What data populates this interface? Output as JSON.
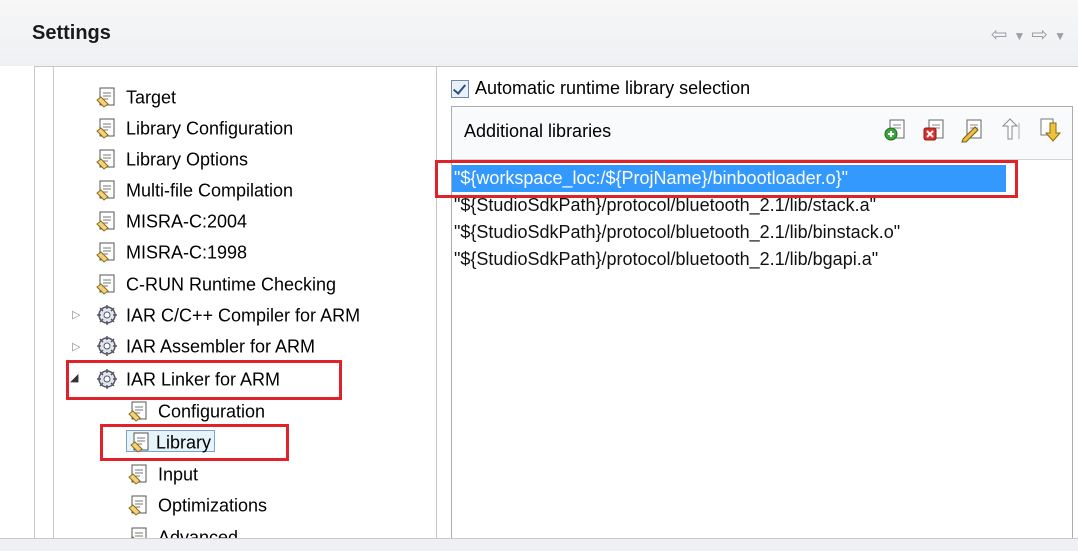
{
  "header": {
    "title": "Settings",
    "nav_back_icon": "arrow-left-icon",
    "nav_dropdown_icon": "chevron-down-icon",
    "nav_forward_icon": "arrow-right-icon"
  },
  "tree": {
    "items": [
      {
        "label": "Target",
        "icon": "options-page-icon"
      },
      {
        "label": "Library Configuration",
        "icon": "options-page-icon"
      },
      {
        "label": "Library Options",
        "icon": "options-page-icon"
      },
      {
        "label": "Multi-file Compilation",
        "icon": "options-page-icon"
      },
      {
        "label": "MISRA-C:2004",
        "icon": "options-page-icon"
      },
      {
        "label": "MISRA-C:1998",
        "icon": "options-page-icon"
      },
      {
        "label": "C-RUN Runtime Checking",
        "icon": "options-page-icon"
      },
      {
        "label": "IAR C/C++ Compiler for ARM",
        "icon": "tool-gear-icon",
        "expander": "collapsed"
      },
      {
        "label": "IAR Assembler for ARM",
        "icon": "tool-gear-icon",
        "expander": "collapsed"
      },
      {
        "label": "IAR Linker for ARM",
        "icon": "tool-gear-icon",
        "expander": "expanded"
      },
      {
        "label": "Configuration",
        "icon": "options-page-icon"
      },
      {
        "label": "Library",
        "icon": "options-page-icon",
        "selected": true
      },
      {
        "label": "Input",
        "icon": "options-page-icon"
      },
      {
        "label": "Optimizations",
        "icon": "options-page-icon"
      },
      {
        "label": "Advanced",
        "icon": "options-page-icon"
      }
    ]
  },
  "runtime": {
    "checkbox_label": "Automatic runtime library selection",
    "checked": true
  },
  "libraries": {
    "title": "Additional libraries",
    "toolbar": [
      "add-icon",
      "delete-icon",
      "edit-icon",
      "move-up-icon",
      "move-down-icon"
    ],
    "rows": [
      "\"${workspace_loc:/${ProjName}/binbootloader.o}\"",
      "\"${StudioSdkPath}/protocol/bluetooth_2.1/lib/stack.a\"",
      "\"${StudioSdkPath}/protocol/bluetooth_2.1/lib/binstack.o\"",
      "\"${StudioSdkPath}/protocol/bluetooth_2.1/lib/bgapi.a\""
    ],
    "selected_index": 0
  },
  "colors": {
    "selection": "#3399ff",
    "highlight_box": "#e0222b"
  }
}
